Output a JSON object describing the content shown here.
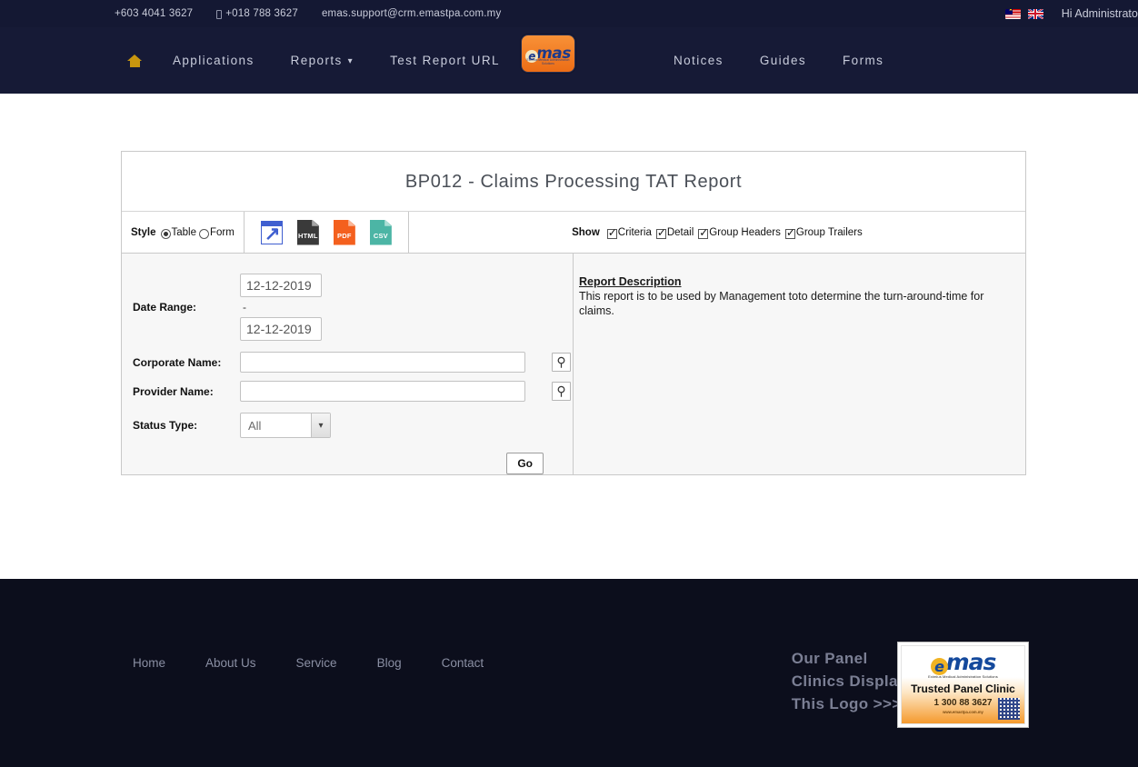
{
  "topbar": {
    "phone_landline": "+603 4041 3627",
    "phone_mobile": "+018 788 3627",
    "email": "emas.support@crm.emastpa.com.my",
    "greeting": "Hi Administrator",
    "flags": [
      "malaysia-flag",
      "uk-flag"
    ]
  },
  "nav": {
    "home_icon": "home-icon",
    "left_items": [
      {
        "label": "Applications",
        "has_caret": false
      },
      {
        "label": "Reports",
        "has_caret": true
      },
      {
        "label": "Test Report URL",
        "has_caret": false
      }
    ],
    "right_items": [
      {
        "label": "Notices"
      },
      {
        "label": "Guides"
      },
      {
        "label": "Forms"
      }
    ],
    "logo": {
      "mark": "e",
      "word": "mas",
      "tagline": "Eximius Medical Administration Solutions"
    }
  },
  "report": {
    "title": "BP012 - Claims Processing TAT Report",
    "toolbar": {
      "style_label": "Style",
      "style_options": [
        {
          "label": "Table",
          "selected": true
        },
        {
          "label": "Form",
          "selected": false
        }
      ],
      "exports": [
        {
          "name": "open-in-new-window-icon",
          "label": "",
          "color": "#3f5fd0"
        },
        {
          "name": "html-export-icon",
          "label": "HTML",
          "color": "#3a3a3a"
        },
        {
          "name": "pdf-export-icon",
          "label": "PDF",
          "color": "#f4601e"
        },
        {
          "name": "csv-export-icon",
          "label": "CSV",
          "color": "#4cb5a5"
        }
      ],
      "show_label": "Show",
      "show_options": [
        {
          "label": "Criteria",
          "checked": true
        },
        {
          "label": "Detail",
          "checked": true
        },
        {
          "label": "Group Headers",
          "checked": true
        },
        {
          "label": "Group Trailers",
          "checked": true
        }
      ]
    },
    "form": {
      "date_range_label": "Date Range:",
      "date_from": "12-12-2019",
      "date_separator": "-",
      "date_to": "12-12-2019",
      "corporate_name_label": "Corporate Name:",
      "corporate_name_value": "",
      "provider_name_label": "Provider Name:",
      "provider_name_value": "",
      "status_type_label": "Status Type:",
      "status_type_value": "All",
      "status_type_options": [
        "All"
      ],
      "go_label": "Go",
      "search_icon": "magnifier-icon"
    },
    "description": {
      "heading": "Report Description",
      "body": "This report is to be used by Management toto determine the turn-around-time for claims."
    }
  },
  "footer": {
    "links": [
      "Home",
      "About Us",
      "Service",
      "Blog",
      "Contact"
    ],
    "panel_text_line1": "Our Panel",
    "panel_text_line2": "Clinics Display",
    "panel_text_line3": "This Logo >>>>",
    "badge": {
      "mark": "e",
      "word": "mas",
      "tagline": "Eximius Medical Administration Solutions",
      "title": "Trusted Panel Clinic",
      "phone": "1 300 88  3627",
      "url": "www.emastpa.com.my"
    }
  },
  "colors": {
    "header_navy": "#141833",
    "nav_navy": "#161a36",
    "footer_navy": "#0c0e1c",
    "accent_gold": "#c8960f",
    "logo_orange": "#ec6d16"
  }
}
